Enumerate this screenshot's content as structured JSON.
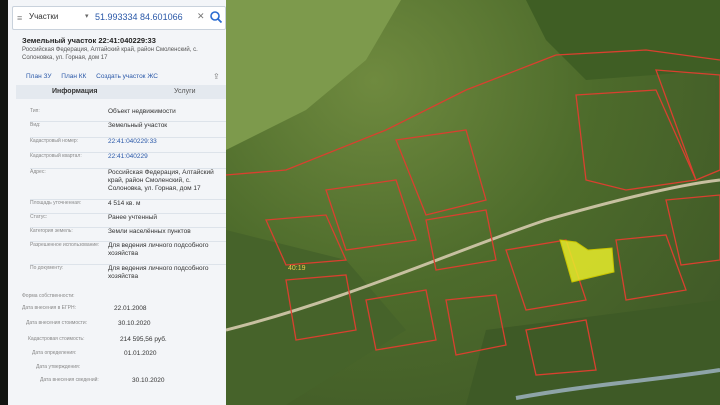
{
  "search": {
    "type_label": "Участки",
    "query": "51.993334 84.601066"
  },
  "object": {
    "title": "Земельный участок 22:41:040229:33",
    "address": "Российская Федерация, Алтайский край, район Смоленский, с. Солоновка, ул. Горная, дом 17"
  },
  "links": [
    "План ЗУ",
    "План КК",
    "Создать участок ЖС"
  ],
  "tabs": {
    "info": "Информация",
    "services": "Услуги"
  },
  "details": [
    {
      "label": "Тип:",
      "value": "Объект недвижимости"
    },
    {
      "label": "Вид:",
      "value": "Земельный участок"
    },
    {
      "label": "Кадастровый номер:",
      "value": "22:41:040229:33",
      "link": true
    },
    {
      "label": "Кадастровый квартал:",
      "value": "22:41:040229",
      "link": true
    },
    {
      "label": "Адрес:",
      "value": "Российская Федерация, Алтайский край, район Смоленский, с. Солоновка, ул. Горная, дом 17"
    },
    {
      "label": "Площадь уточненная:",
      "value": "4 514 кв. м"
    },
    {
      "label": "Статус:",
      "value": "Ранее учтенный"
    },
    {
      "label": "Категория земель:",
      "value": "Земли населённых пунктов"
    },
    {
      "label": "Разрешенное использование:",
      "value": "Для ведения личного подсобного хозяйства"
    },
    {
      "label": "По документу:",
      "value": "Для ведения личного подсобного хозяйства"
    }
  ],
  "extra": [
    {
      "label": "Форма собственности:",
      "value": ""
    },
    {
      "label": "Дата внесения в ЕГРН:",
      "value": "22.01.2008"
    },
    {
      "label": "Дата внесения стоимости:",
      "value": "30.10.2020"
    },
    {
      "label": "Кадастровая стоимость:",
      "value": "214 595,56 руб."
    },
    {
      "label": "Дата определения:",
      "value": "01.01.2020"
    },
    {
      "label": "Дата утверждения:",
      "value": ""
    },
    {
      "label": "Дата внесения сведений:",
      "value": "30.10.2020"
    }
  ],
  "map": {
    "label": "40:19"
  },
  "colors": {
    "parcel_line": "#d9402f",
    "selected_parcel": "#e8ec2a",
    "link": "#2a58a8"
  }
}
